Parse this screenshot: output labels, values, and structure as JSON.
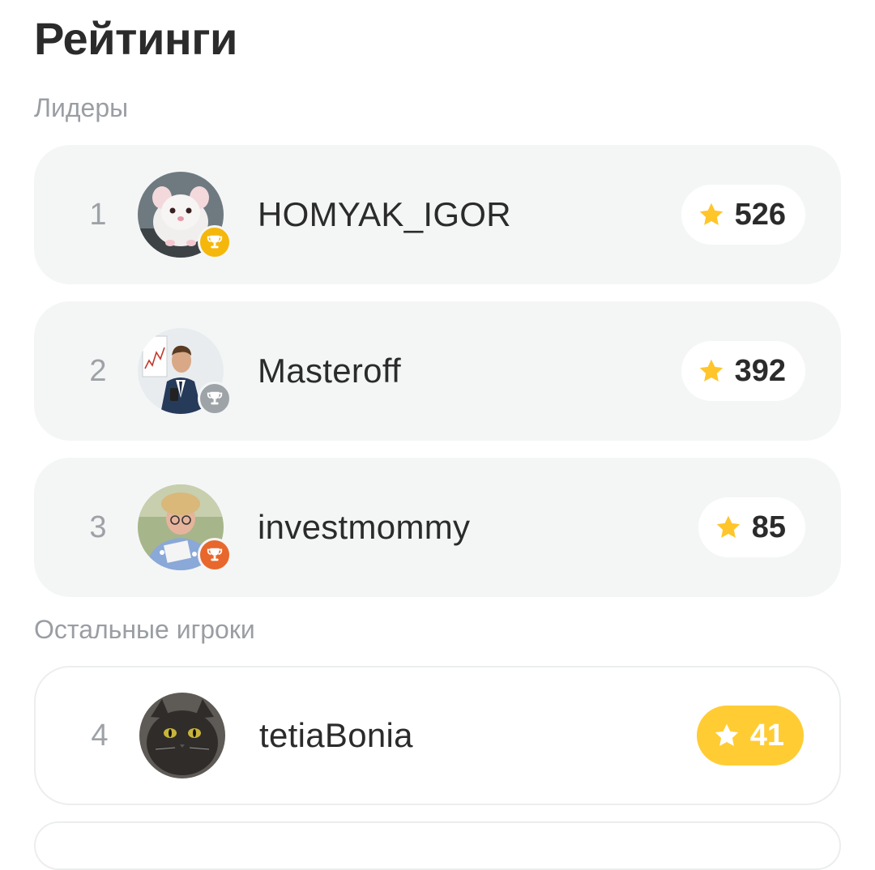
{
  "page": {
    "title": "Рейтинги"
  },
  "sections": {
    "leaders_label": "Лидеры",
    "others_label": "Остальные игроки"
  },
  "colors": {
    "gold": "#f5b70a",
    "silver": "#9ea3a8",
    "bronze": "#e8672c",
    "star": "#ffc52a",
    "highlight_pill": "#ffcc33",
    "card_bg": "#f4f6f6"
  },
  "leaders": [
    {
      "rank": "1",
      "name": "HOMYAK_IGOR",
      "score": "526",
      "medal": "gold-trophy-icon",
      "avatar": "hamster-avatar"
    },
    {
      "rank": "2",
      "name": "Masteroff",
      "score": "392",
      "medal": "silver-trophy-icon",
      "avatar": "businessman-avatar"
    },
    {
      "rank": "3",
      "name": "investmommy",
      "score": "85",
      "medal": "bronze-trophy-icon",
      "avatar": "grandma-avatar"
    }
  ],
  "others": [
    {
      "rank": "4",
      "name": "tetiaBonia",
      "score": "41",
      "avatar": "cat-avatar",
      "highlighted": true
    }
  ]
}
